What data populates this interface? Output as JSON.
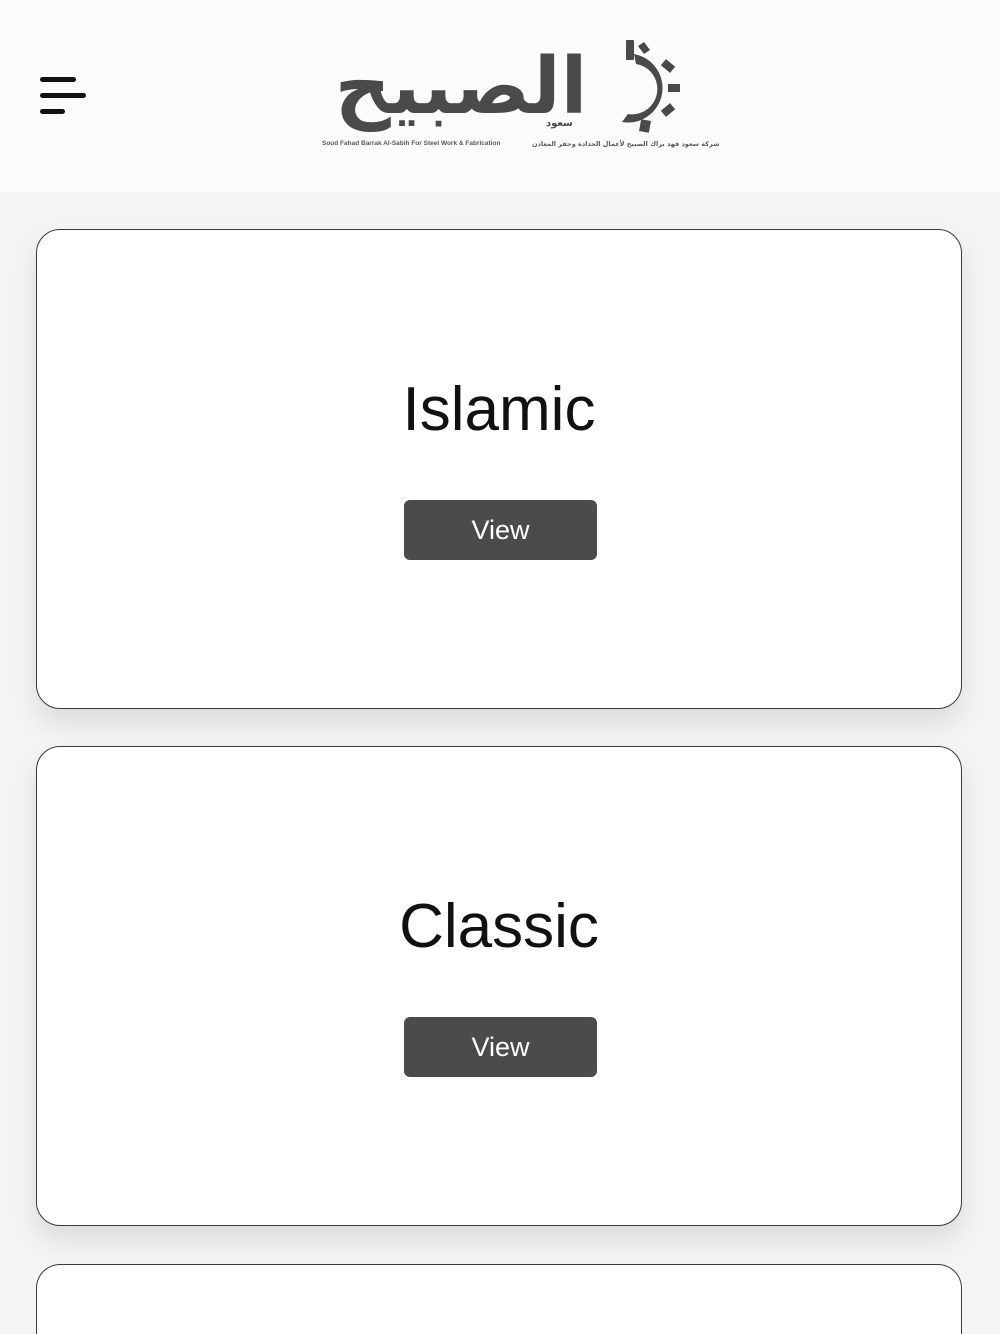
{
  "header": {
    "menu_icon": "hamburger-menu-icon",
    "logo": {
      "arabic_name": "الصبيح",
      "arabic_small": "سعود",
      "english_tagline": "Soud Fahad Barrak Al-Sabih For Steel Work & Fabrication",
      "arabic_tagline": "شركة سعود فهد براك الصبيح لأعمال الحدادة وحفر المعادن",
      "icon": "gear-icon"
    }
  },
  "cards": [
    {
      "title": "Islamic",
      "button_label": "View"
    },
    {
      "title": "Classic",
      "button_label": "View"
    },
    {
      "title": "",
      "button_label": ""
    }
  ],
  "colors": {
    "button_bg": "#4b4b4b",
    "logo_gray": "#4a4a4a",
    "page_bg": "#f4f4f4"
  }
}
